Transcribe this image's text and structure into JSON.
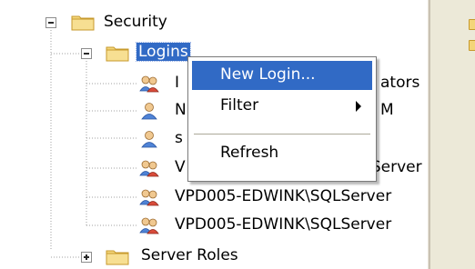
{
  "tree": {
    "security_label": "Security",
    "logins_label": "Logins",
    "server_roles_label": "Server Roles",
    "logins": [
      {
        "text": "I",
        "tail": "ators"
      },
      {
        "text": "N",
        "tail": "M"
      },
      {
        "text": "s",
        "tail": ""
      },
      {
        "text": "V",
        "tail": "QLServer"
      },
      {
        "text": "VPD005-EDWINK\\SQLServer",
        "tail": ""
      },
      {
        "text": "VPD005-EDWINK\\SQLServer",
        "tail": ""
      }
    ]
  },
  "context_menu": {
    "new_login": "New Login...",
    "filter": "Filter",
    "refresh": "Refresh"
  },
  "colors": {
    "selection": "#316ac5",
    "folder": "#f3d57a"
  }
}
